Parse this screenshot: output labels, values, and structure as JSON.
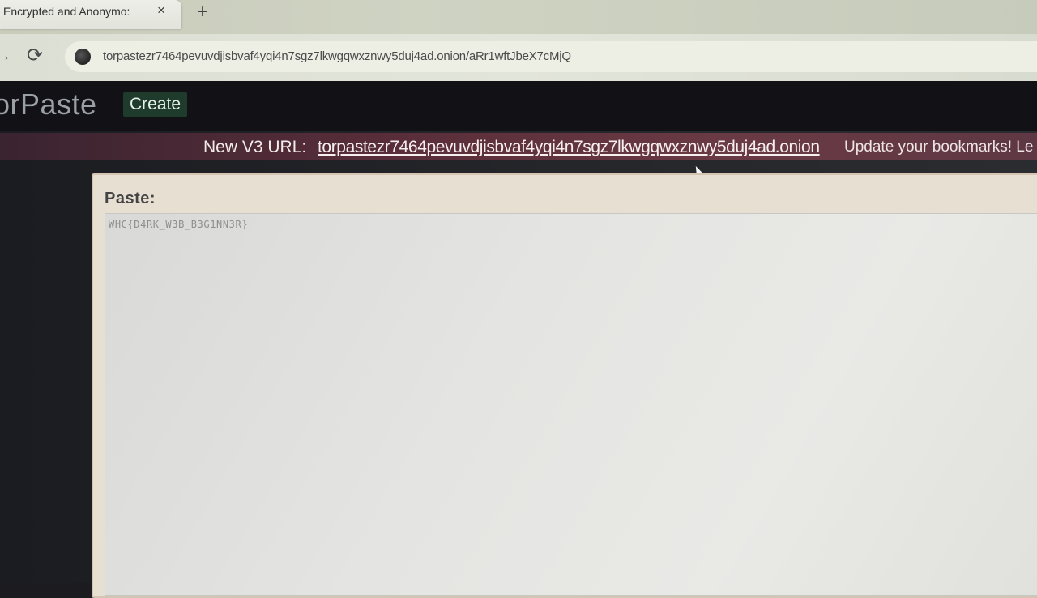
{
  "browser": {
    "tab_title": "Encrypted and Anonymo:",
    "tab_close": "×",
    "new_tab": "+",
    "url": "torpastezr7464pevuvdjisbvaf4yqi4n7sgz7lkwgqwxznwy5duj4ad.onion/aRr1wftJbeX7cMjQ"
  },
  "header": {
    "brand": "orPaste",
    "create_label": "Create"
  },
  "notice": {
    "prefix": "New V3 URL:",
    "link": "torpastezr7464pevuvdjisbvaf4yqi4n7sgz7lkwgqwxznwy5duj4ad.onion",
    "suffix": "Update your bookmarks! Le"
  },
  "paste": {
    "label": "Paste:",
    "content": "WHC{D4RK_W3B_B3G1NN3R}"
  },
  "icons": {
    "reload": "reload-icon",
    "back": "back-arrow-icon",
    "site": "site-security-icon"
  }
}
